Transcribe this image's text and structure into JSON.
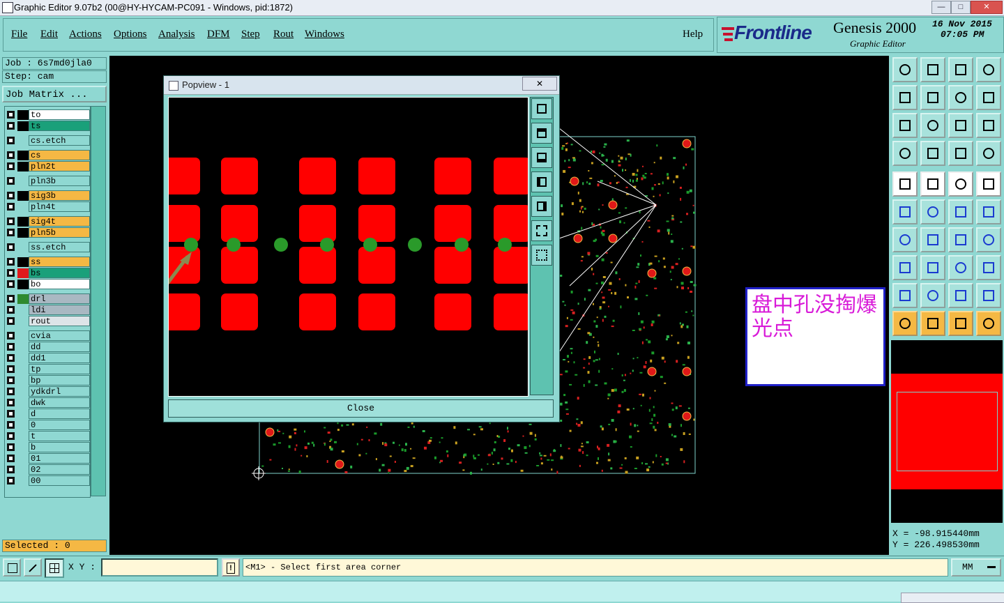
{
  "window": {
    "title": "Graphic Editor 9.07b2 (00@HY-HYCAM-PC091 - Windows, pid:1872)",
    "controls": {
      "minimize": "—",
      "maximize": "□",
      "close": "✕"
    }
  },
  "menu": {
    "items": [
      "File",
      "Edit",
      "Actions",
      "Options",
      "Analysis",
      "DFM",
      "Step",
      "Rout",
      "Windows"
    ],
    "help": "Help"
  },
  "brand": {
    "logo": "Frontline",
    "product": "Genesis 2000",
    "subtitle": "Graphic Editor",
    "date": "16 Nov 2015",
    "time": "07:05 PM"
  },
  "job": {
    "job_label": "Job : 6s7md0jla0",
    "step_label": "Step: cam",
    "matrix_button": "Job Matrix ..."
  },
  "layers": [
    {
      "name": "to",
      "bg": "#ffffff",
      "color": "#000000"
    },
    {
      "name": "ts",
      "bg": "#1aa07a",
      "color": "#000000"
    },
    {
      "name": "cs.etch",
      "bg": "#8fd8d2",
      "color": ""
    },
    {
      "name": "cs",
      "bg": "#f5b844",
      "color": "#000000"
    },
    {
      "name": "pln2t",
      "bg": "#f5b844",
      "color": "#000000"
    },
    {
      "name": "pln3b",
      "bg": "#8fd8d2",
      "color": ""
    },
    {
      "name": "sig3b",
      "bg": "#f5b844",
      "color": "#000000"
    },
    {
      "name": "pln4t",
      "bg": "#8fd8d2",
      "color": ""
    },
    {
      "name": "sig4t",
      "bg": "#f5b844",
      "color": "#000000"
    },
    {
      "name": "pln5b",
      "bg": "#f5b844",
      "color": "#000000"
    },
    {
      "name": "ss.etch",
      "bg": "#8fd8d2",
      "color": ""
    },
    {
      "name": "ss",
      "bg": "#f5b844",
      "color": "#000000"
    },
    {
      "name": "bs",
      "bg": "#1aa07a",
      "color": "#e0191c"
    },
    {
      "name": "bo",
      "bg": "#ffffff",
      "color": "#000000"
    },
    {
      "name": "drl",
      "bg": "#a9b8c2",
      "color": "#2f8a2f"
    },
    {
      "name": "ldi",
      "bg": "#a9b8c2",
      "color": ""
    },
    {
      "name": "rout",
      "bg": "#dde4e8",
      "color": ""
    },
    {
      "name": "cvia",
      "bg": "#8fd8d2",
      "color": ""
    },
    {
      "name": "dd",
      "bg": "#8fd8d2",
      "color": ""
    },
    {
      "name": "dd1",
      "bg": "#8fd8d2",
      "color": ""
    },
    {
      "name": "tp",
      "bg": "#8fd8d2",
      "color": ""
    },
    {
      "name": "bp",
      "bg": "#8fd8d2",
      "color": ""
    },
    {
      "name": "ydkdrl",
      "bg": "#8fd8d2",
      "color": ""
    },
    {
      "name": "dwk",
      "bg": "#8fd8d2",
      "color": ""
    },
    {
      "name": "d",
      "bg": "#8fd8d2",
      "color": ""
    },
    {
      "name": "0",
      "bg": "#8fd8d2",
      "color": ""
    },
    {
      "name": "t",
      "bg": "#8fd8d2",
      "color": ""
    },
    {
      "name": "b",
      "bg": "#8fd8d2",
      "color": ""
    },
    {
      "name": "01",
      "bg": "#8fd8d2",
      "color": ""
    },
    {
      "name": "02",
      "bg": "#8fd8d2",
      "color": ""
    },
    {
      "name": "00",
      "bg": "#8fd8d2",
      "color": ""
    }
  ],
  "selected": "Selected : 0",
  "popup": {
    "title": "Popview - 1",
    "close": "Close",
    "close_x": "✕"
  },
  "annotation": "盘中孔没掏爆光点",
  "coords": {
    "x": "X = -98.915440mm",
    "y": "Y = 226.498530mm"
  },
  "status": {
    "xy_label": "X Y :",
    "xy_value": "",
    "prompt": "<M1> - Select first area corner",
    "units": "MM"
  },
  "colors": {
    "panel": "#8fd8d2",
    "pad": "#ff0000",
    "via": "#2a9a2a",
    "accent_orange": "#f5b844"
  }
}
